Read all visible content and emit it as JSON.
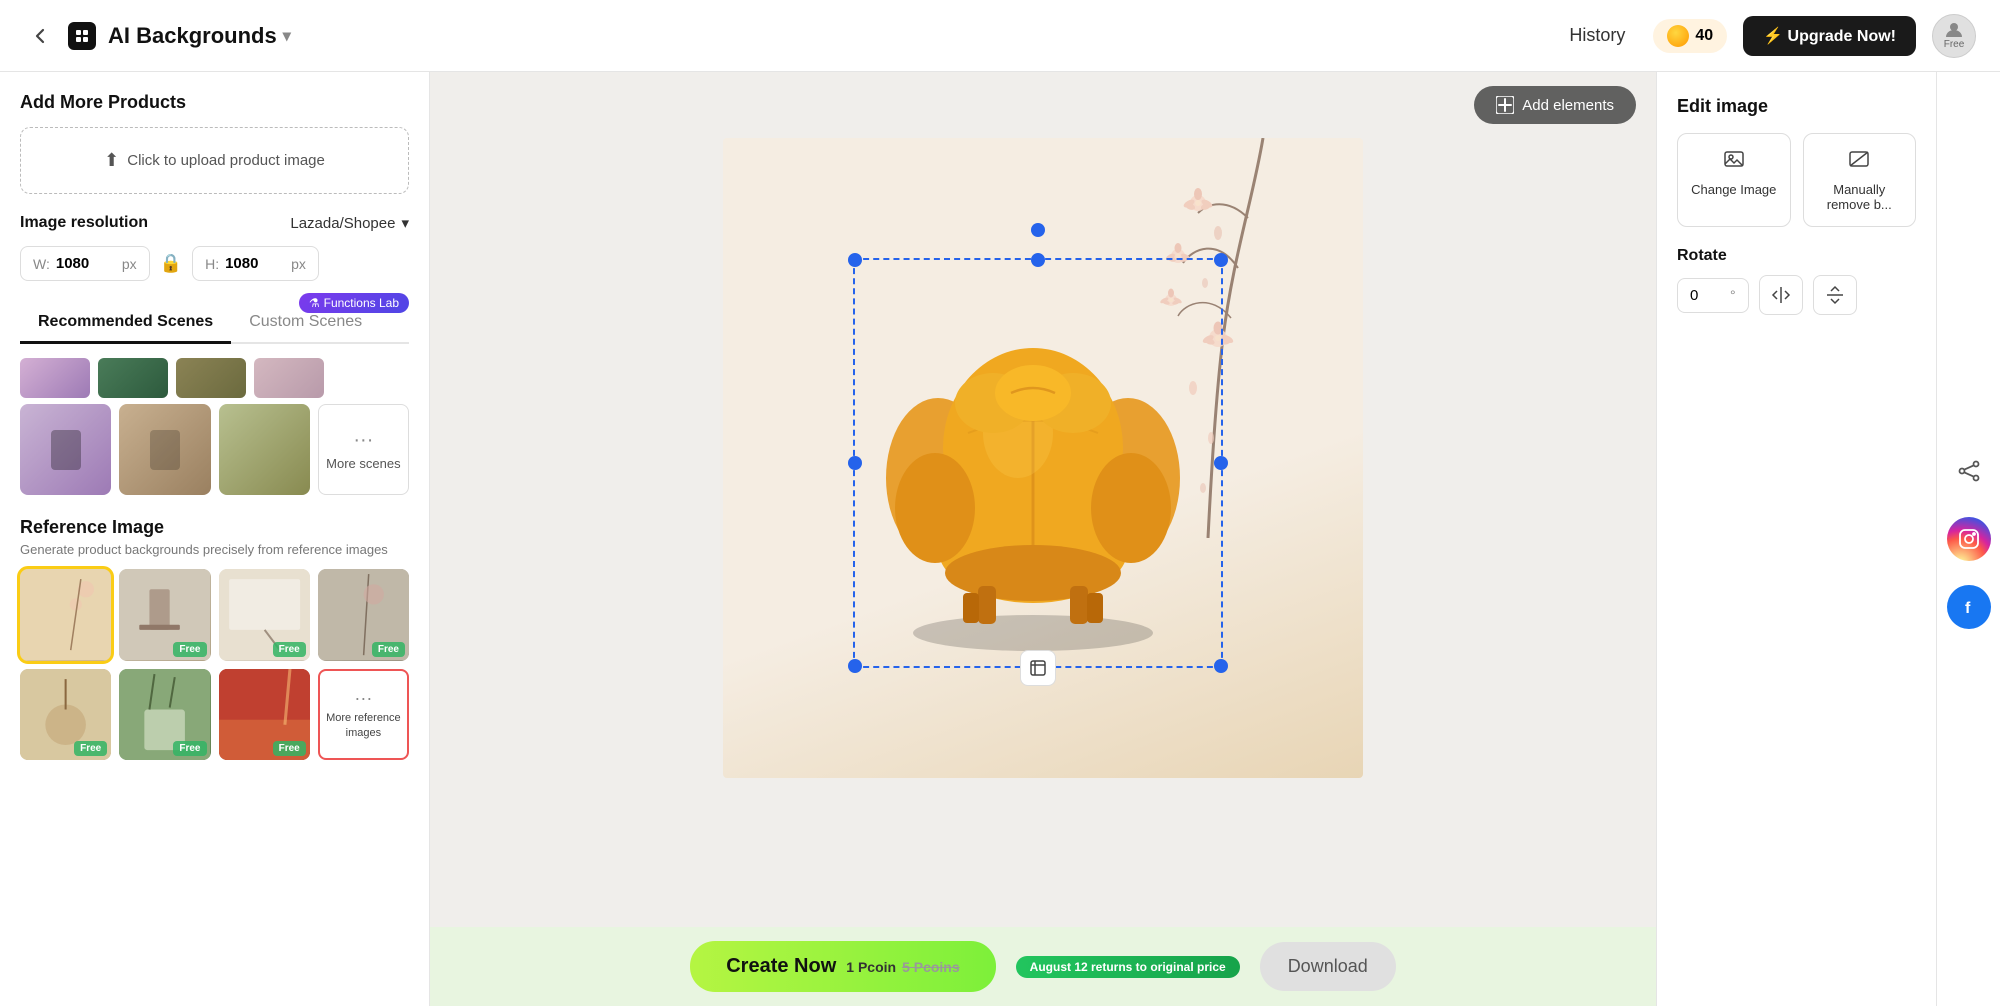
{
  "nav": {
    "back_icon": "←",
    "app_icon": "⬛",
    "app_title": "AI Backgrounds",
    "dropdown_icon": "▾",
    "history_label": "History",
    "coins": "40",
    "upgrade_label": "⚡ Upgrade Now!",
    "user_label": "Free"
  },
  "left_panel": {
    "add_products_title": "Add More Products",
    "upload_label": "Click to upload product image",
    "upload_icon": "↑",
    "resolution_label": "Image resolution",
    "resolution_preset": "Lazada/Shopee",
    "width_label": "W:",
    "width_value": "1080",
    "width_unit": "px",
    "height_label": "H:",
    "height_value": "1080",
    "height_unit": "px",
    "functions_badge": "⚗ Functions Lab",
    "tab_recommended": "Recommended Scenes",
    "tab_custom": "Custom Scenes",
    "more_scenes_dots": "···",
    "more_scenes_label": "More scenes",
    "ref_image_title": "Reference Image",
    "ref_image_subtitle": "Generate product backgrounds precisely from reference images",
    "more_ref_dots": "···",
    "more_ref_label": "More reference images",
    "free_label": "Free"
  },
  "canvas": {
    "add_elements_label": "Add elements"
  },
  "bottom_bar": {
    "create_label": "Create Now",
    "pcoin_current": "1 Pcoin",
    "pcoin_original": "5 Pcoins",
    "promo_label": "August 12 returns to original price",
    "download_label": "Download"
  },
  "right_panel": {
    "edit_title": "Edit image",
    "change_image_label": "Change Image",
    "remove_bg_label": "Manually remove b...",
    "rotate_title": "Rotate",
    "rotate_value": "0",
    "rotate_unit": "°"
  },
  "social": {
    "share_icon": "share",
    "instagram_icon": "instagram",
    "facebook_icon": "facebook"
  }
}
